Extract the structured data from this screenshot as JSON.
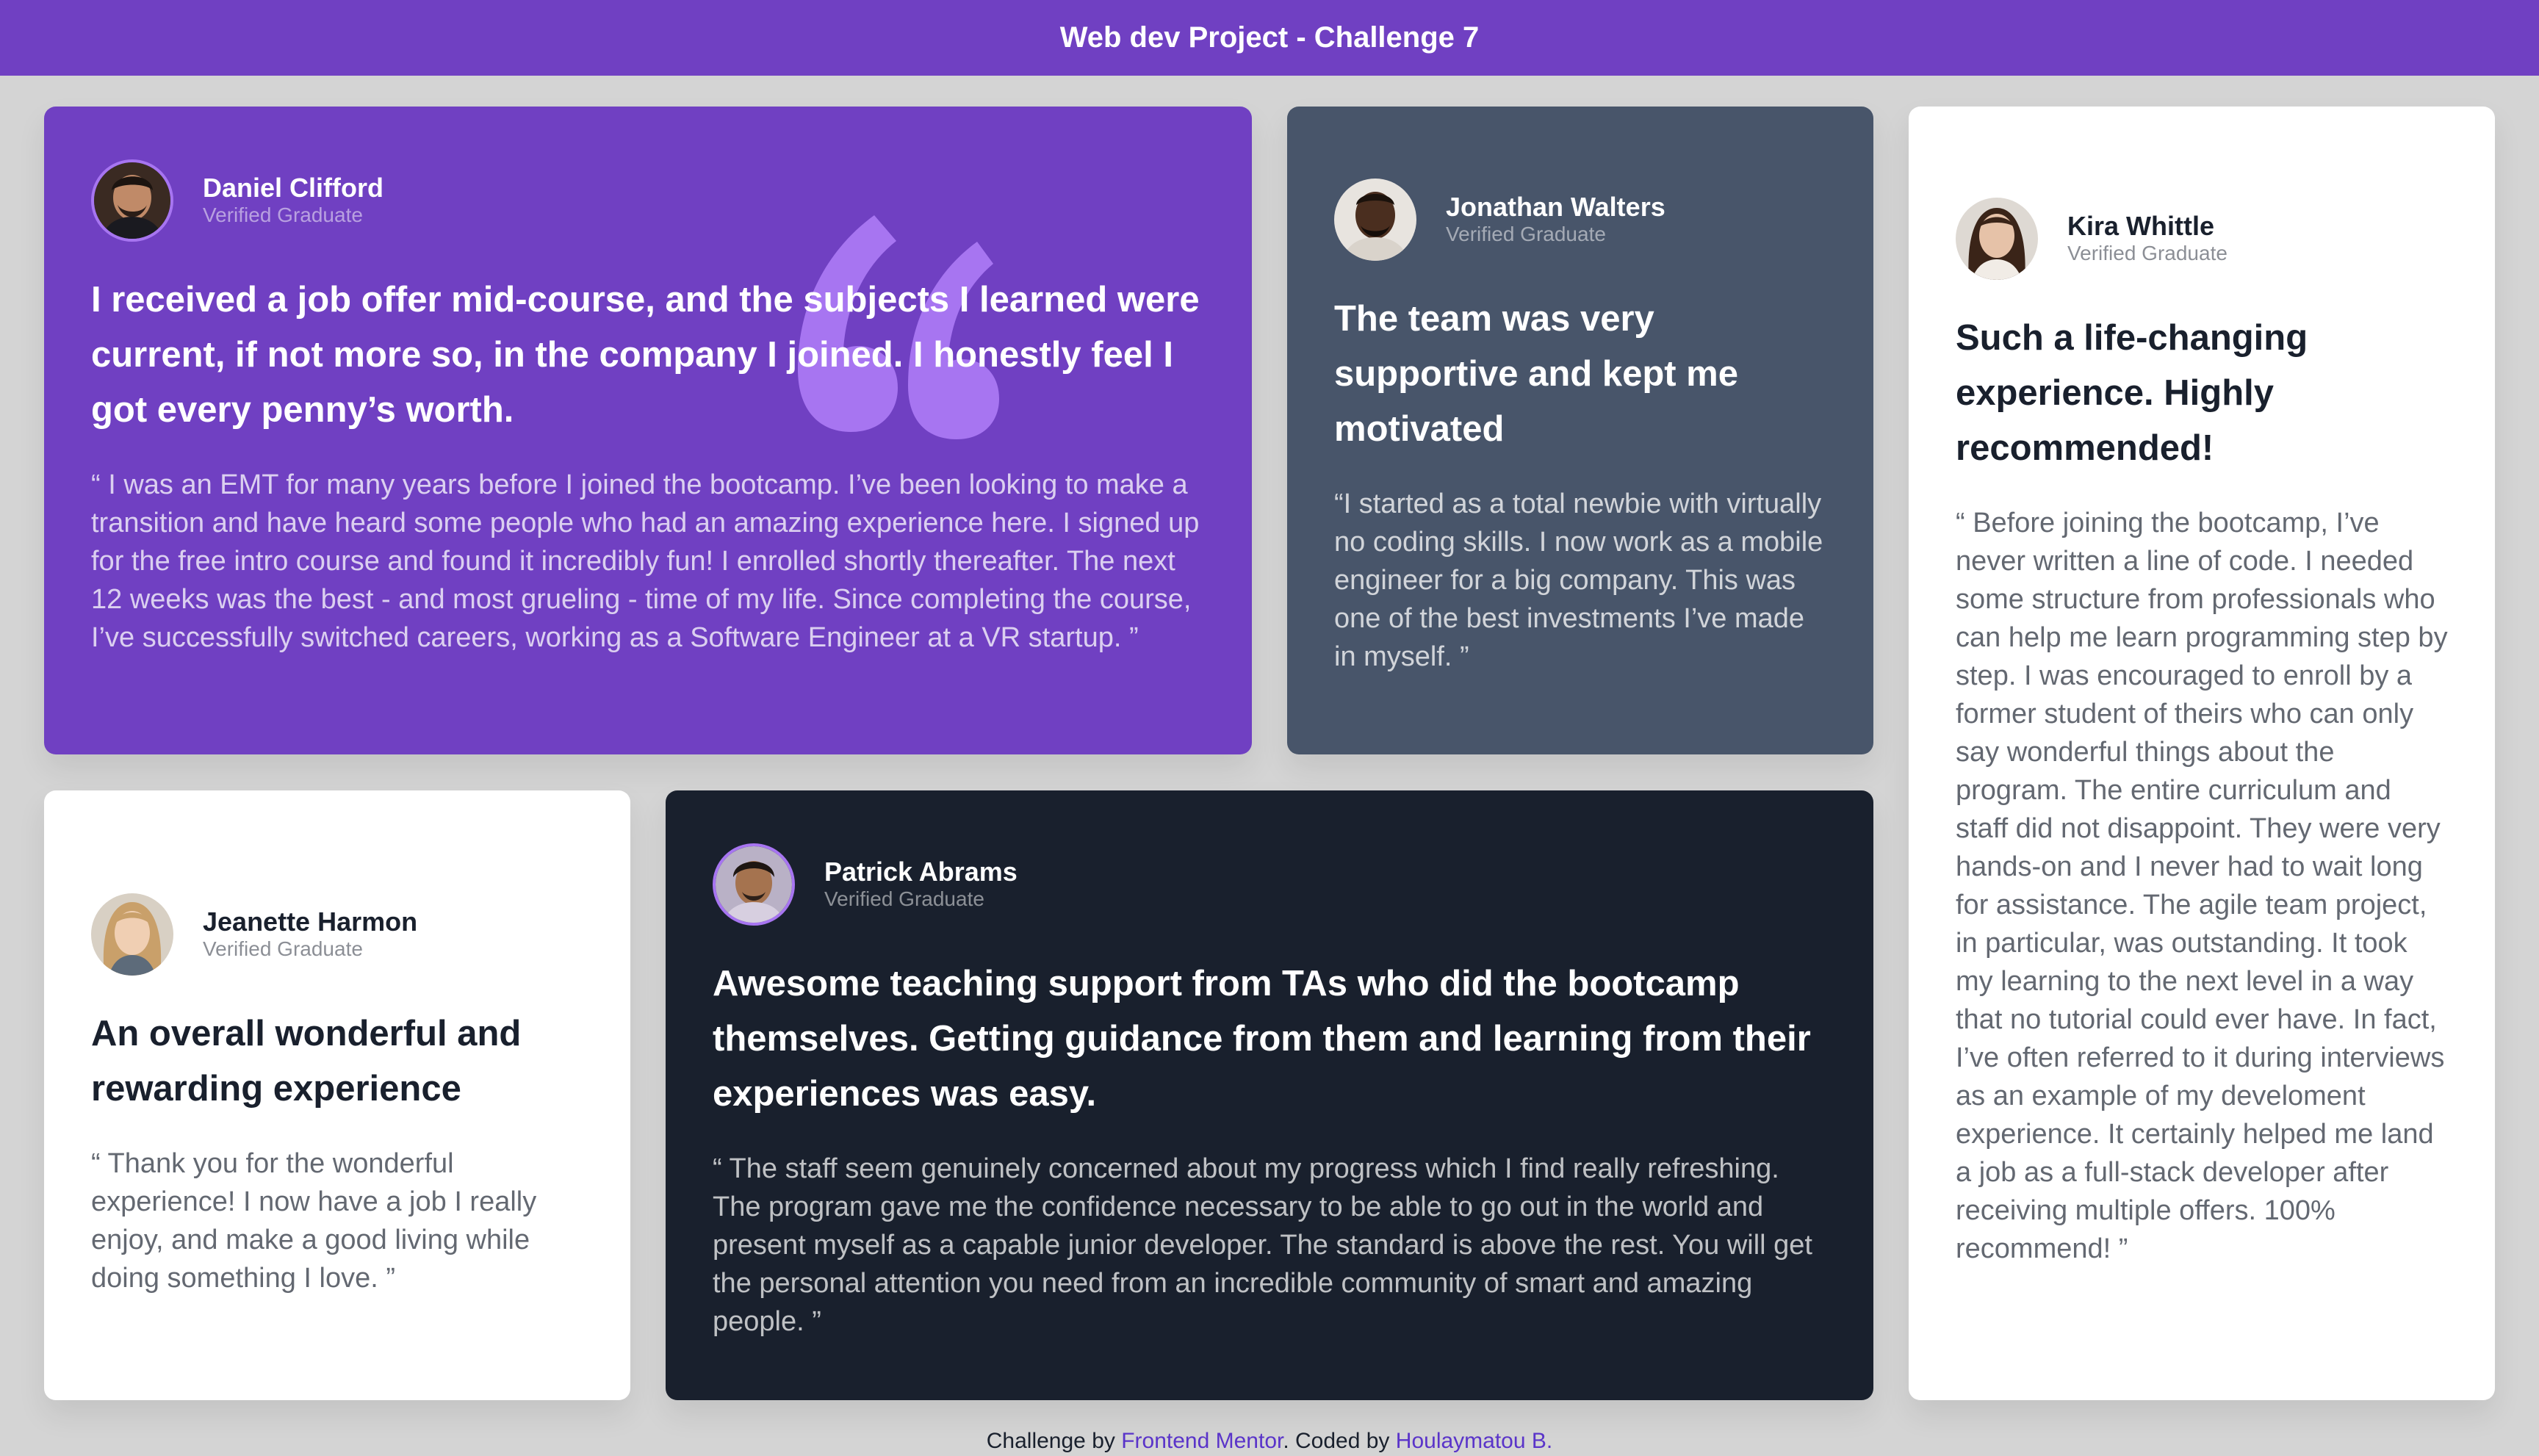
{
  "header": {
    "title": "Web dev Project - Challenge 7"
  },
  "testimonials": [
    {
      "name": "Daniel Clifford",
      "role": "Verified Graduate",
      "headline": "I received a job offer mid-course, and the subjects I learned were current, if not more so, in the company I joined. I honestly feel I got every penny’s worth.",
      "quote": "“ I was an EMT for many years before I joined the bootcamp. I’ve been looking to make a transition and have heard some people who had an amazing experience here. I signed up for the free intro course and found it incredibly fun! I enrolled shortly thereafter. The next 12 weeks was the best - and most grueling - time of my life. Since completing the course, I’ve successfully switched careers, working as a Software Engineer at a VR startup. ”",
      "theme": "purple"
    },
    {
      "name": "Jonathan Walters",
      "role": "Verified Graduate",
      "headline": "The team was very supportive and kept me motivated",
      "quote": "“I started as a total newbie with virtually no coding skills. I now work as a mobile engineer for a big company. This was one of the best investments I’ve made in myself. ”",
      "theme": "slate"
    },
    {
      "name": "Kira Whittle",
      "role": "Verified Graduate",
      "headline": "Such a life-changing experience. Highly recommended!",
      "quote": "“ Before joining the bootcamp, I’ve never written a line of code. I needed some structure from professionals who can help me learn programming step by step. I was encouraged to enroll by a former student of theirs who can only say wonderful things about the program. The entire curriculum and staff did not disappoint. They were very hands-on and I never had to wait long for assistance. The agile team project, in particular, was outstanding. It took my learning to the next level in a way that no tutorial could ever have. In fact, I’ve often referred to it during interviews as an example of my develoment experience. It certainly helped me land a job as a full-stack developer after receiving multiple offers. 100% recommend! ”",
      "theme": "white"
    },
    {
      "name": "Jeanette Harmon",
      "role": "Verified Graduate",
      "headline": "An overall wonderful and rewarding experience",
      "quote": "“ Thank you for the wonderful experience! I now have a job I really enjoy, and make a good living while doing something I love. ”",
      "theme": "white"
    },
    {
      "name": "Patrick Abrams",
      "role": "Verified Graduate",
      "headline": "Awesome teaching support from TAs who did the bootcamp themselves. Getting guidance from them and learning from their experiences was easy.",
      "quote": "“ The staff seem genuinely concerned about my progress which I find really refreshing. The program gave me the confidence necessary to be able to go out in the world and present myself as a capable junior developer. The standard is above the rest. You will get the personal attention you need from an incredible community of smart and amazing people. ”",
      "theme": "dark"
    }
  ],
  "footer": {
    "prefix": "Challenge by ",
    "link1": "Frontend Mentor",
    "middle": ". Coded by ",
    "link2": "Houlaymatou B."
  },
  "colors": {
    "header_bg": "#7040c2",
    "purple_card": "#7040c2",
    "slate_card": "#48556a",
    "dark_card": "#19202d",
    "white_card": "#ffffff",
    "page_bg": "#d4d4d4",
    "link": "#5a34c9",
    "quote_mark": "#a775f1"
  },
  "icons": {
    "quote_decoration": "quote-mark-icon"
  }
}
